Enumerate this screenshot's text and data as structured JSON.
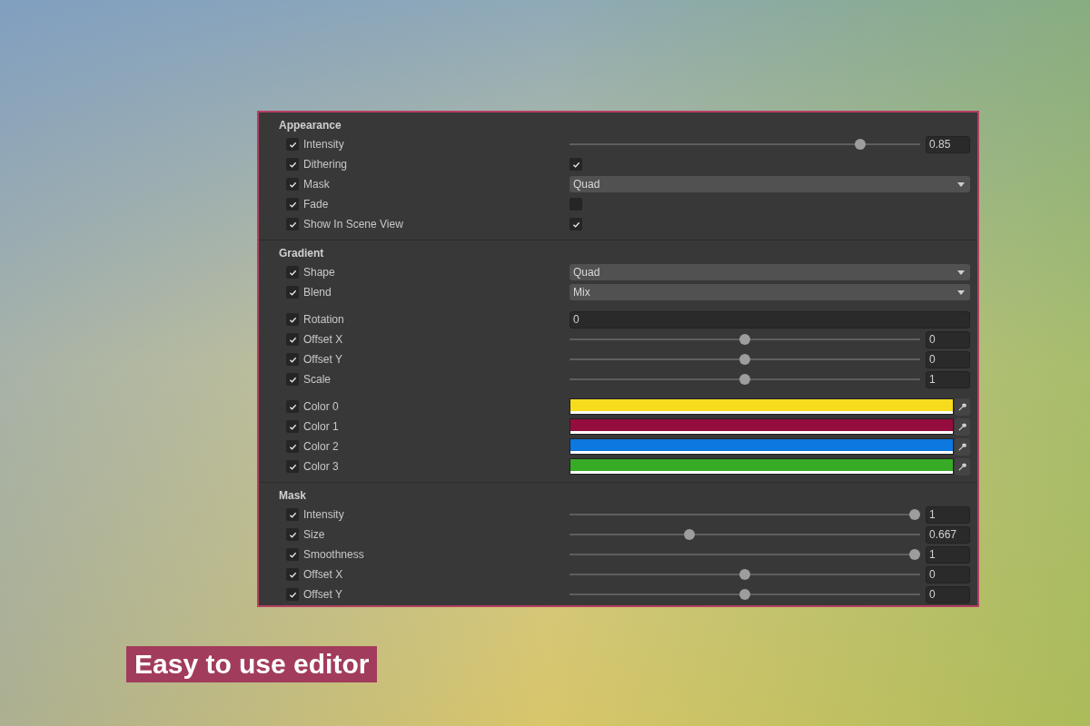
{
  "sections": [
    {
      "title": "Appearance",
      "groups": [
        [
          {
            "kind": "slider",
            "label": "Intensity",
            "enabled": true,
            "level": 0.84,
            "value": "0.85"
          },
          {
            "kind": "toggle",
            "label": "Dithering",
            "enabled": true,
            "checked": true
          },
          {
            "kind": "dropdown",
            "label": "Mask",
            "enabled": true,
            "value": "Quad"
          },
          {
            "kind": "toggle",
            "label": "Fade",
            "enabled": true,
            "checked": false
          },
          {
            "kind": "toggle",
            "label": "Show In Scene View",
            "enabled": true,
            "checked": true
          }
        ]
      ]
    },
    {
      "title": "Gradient",
      "groups": [
        [
          {
            "kind": "dropdown",
            "label": "Shape",
            "enabled": true,
            "value": "Quad"
          },
          {
            "kind": "dropdown",
            "label": "Blend",
            "enabled": true,
            "value": "Mix"
          }
        ],
        [
          {
            "kind": "number",
            "label": "Rotation",
            "enabled": true,
            "value": "0"
          },
          {
            "kind": "slider",
            "label": "Offset X",
            "enabled": true,
            "level": 0.5,
            "value": "0"
          },
          {
            "kind": "slider",
            "label": "Offset Y",
            "enabled": true,
            "level": 0.5,
            "value": "0"
          },
          {
            "kind": "slider",
            "label": "Scale",
            "enabled": true,
            "level": 0.5,
            "value": "1"
          }
        ],
        [
          {
            "kind": "color",
            "label": "Color 0",
            "enabled": true,
            "color": "#f7dc1e"
          },
          {
            "kind": "color",
            "label": "Color 1",
            "enabled": true,
            "color": "#950d3e"
          },
          {
            "kind": "color",
            "label": "Color 2",
            "enabled": true,
            "color": "#0c78e0"
          },
          {
            "kind": "color",
            "label": "Color 3",
            "enabled": true,
            "color": "#37ab26"
          }
        ]
      ]
    },
    {
      "title": "Mask",
      "groups": [
        [
          {
            "kind": "slider",
            "label": "Intensity",
            "enabled": true,
            "level": 1,
            "value": "1"
          },
          {
            "kind": "slider",
            "label": "Size",
            "enabled": true,
            "level": 0.337,
            "value": "0.667"
          },
          {
            "kind": "slider",
            "label": "Smoothness",
            "enabled": true,
            "level": 1,
            "value": "1"
          },
          {
            "kind": "slider",
            "label": "Offset X",
            "enabled": true,
            "level": 0.5,
            "value": "0"
          },
          {
            "kind": "slider",
            "label": "Offset Y",
            "enabled": true,
            "level": 0.5,
            "value": "0"
          }
        ]
      ]
    }
  ],
  "caption": "Easy to use editor"
}
